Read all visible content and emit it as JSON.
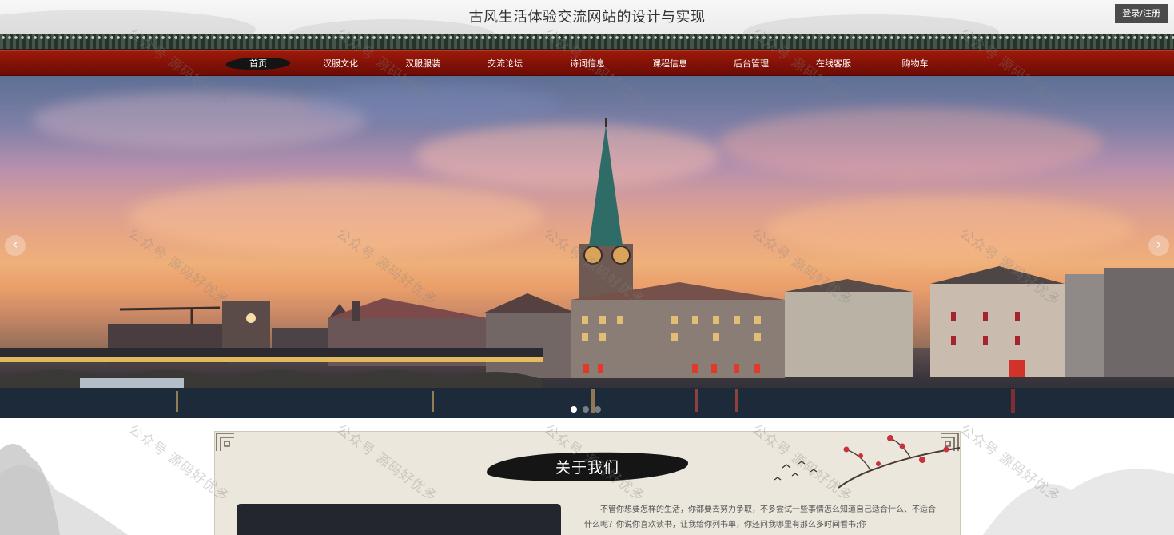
{
  "header": {
    "title": "古风生活体验交流网站的设计与实现",
    "login_label": "登录/注册"
  },
  "nav": {
    "items": [
      {
        "label": "首页",
        "active": true
      },
      {
        "label": "汉服文化",
        "active": false
      },
      {
        "label": "汉服服装",
        "active": false
      },
      {
        "label": "交流论坛",
        "active": false
      },
      {
        "label": "诗词信息",
        "active": false
      },
      {
        "label": "课程信息",
        "active": false
      },
      {
        "label": "后台管理",
        "active": false
      },
      {
        "label": "在线客服",
        "active": false
      },
      {
        "label": "购物车",
        "active": false
      }
    ]
  },
  "carousel": {
    "prev_icon": "‹",
    "next_icon": "›",
    "slide_count": 3,
    "active_index": 0
  },
  "about": {
    "heading": "关于我们",
    "text": "不管你想要怎样的生活，你都要去努力争取，不多尝试一些事情怎么知道自己适合什么、不适合什么呢？你说你喜欢读书，让我给你列书单，你还问我哪里有那么多时间看书;你"
  },
  "watermark": {
    "text": "公众号 源码好优多"
  },
  "colors": {
    "nav_red": "#7e1006",
    "roof_tile": "#2b3a31",
    "panel_bg": "#ece7dd",
    "brush_black": "#151515"
  }
}
